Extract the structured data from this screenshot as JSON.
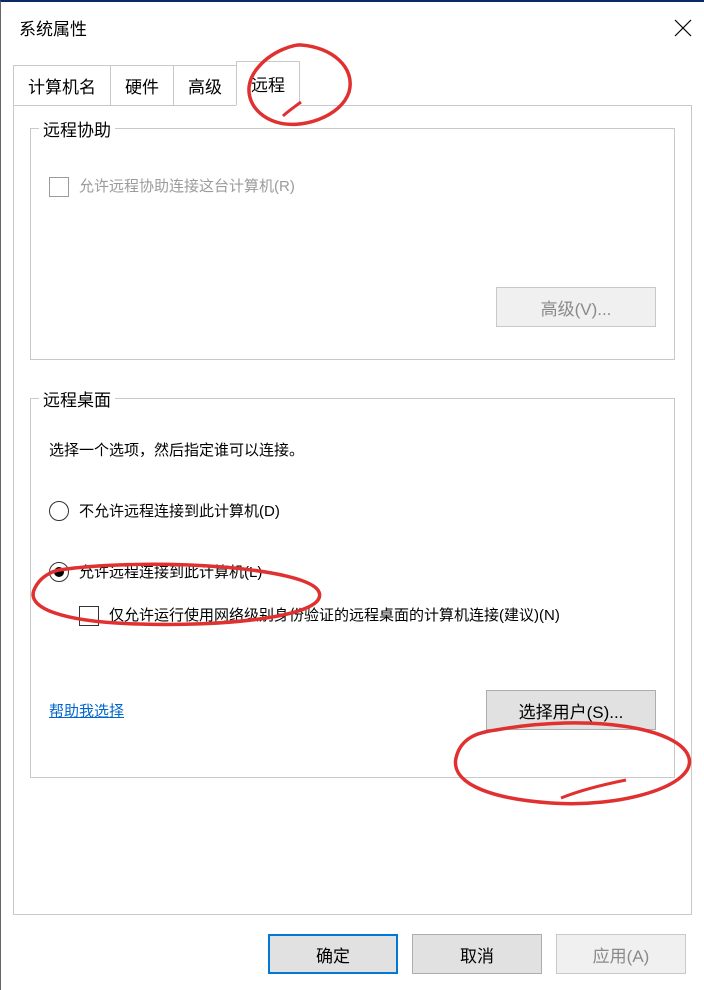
{
  "window": {
    "title": "系统属性"
  },
  "tabs": {
    "names": [
      "计算机名",
      "硬件",
      "高级",
      "远程"
    ],
    "active_index": 3
  },
  "remote_assist": {
    "legend": "远程协助",
    "checkbox_label": "允许远程协助连接这台计算机(R)",
    "advanced_button": "高级(V)..."
  },
  "remote_desktop": {
    "legend": "远程桌面",
    "instruction": "选择一个选项，然后指定谁可以连接。",
    "radio_deny": "不允许远程连接到此计算机(D)",
    "radio_allow": "允许远程连接到此计算机(L)",
    "nla_checkbox": "仅允许运行使用网络级别身份验证的远程桌面的计算机连接(建议)(N)",
    "help_link": "帮助我选择",
    "select_users_button": "选择用户(S)..."
  },
  "buttons": {
    "ok": "确定",
    "cancel": "取消",
    "apply": "应用(A)"
  }
}
